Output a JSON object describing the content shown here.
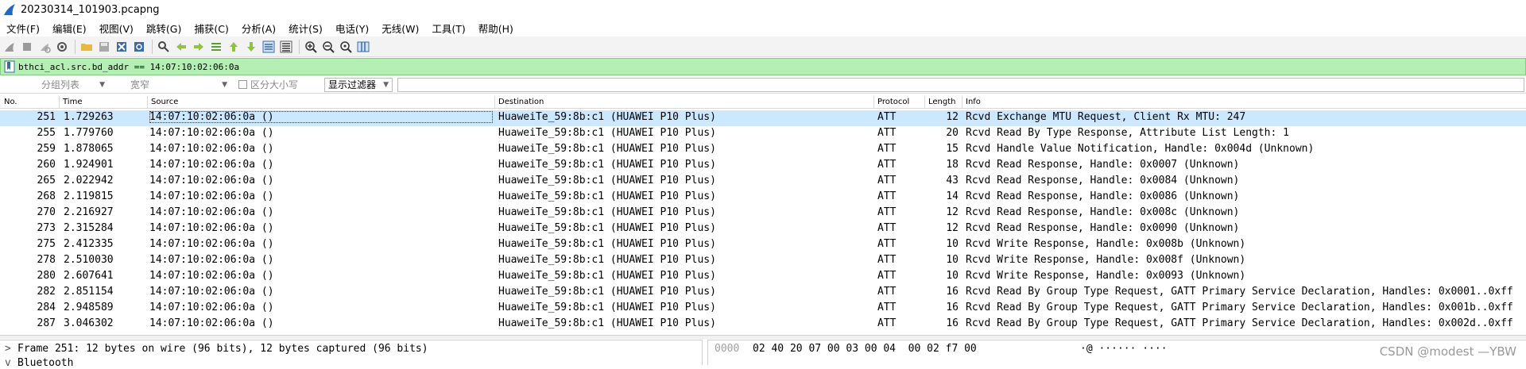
{
  "window": {
    "title": "20230314_101903.pcapng"
  },
  "menu": [
    "文件(F)",
    "编辑(E)",
    "视图(V)",
    "跳转(G)",
    "捕获(C)",
    "分析(A)",
    "统计(S)",
    "电话(Y)",
    "无线(W)",
    "工具(T)",
    "帮助(H)"
  ],
  "toolbar": {
    "icons": [
      "shark-fin-start-icon",
      "stop-icon",
      "restart-icon",
      "options-gear-icon",
      "open-folder-icon",
      "save-icon",
      "close-file-icon",
      "reload-icon",
      "find-icon",
      "back-arrow-icon",
      "forward-arrow-icon",
      "go-to-packet-icon",
      "first-packet-icon",
      "last-packet-icon",
      "autoscroll-icon",
      "colorize-icon",
      "zoom-in-icon",
      "zoom-out-icon",
      "normal-size-icon",
      "resize-columns-icon"
    ]
  },
  "filter": {
    "text": "bthci_acl.src.bd_addr == 14:07:10:02:06:0a"
  },
  "search": {
    "scope": "分组列表",
    "charset": "宽窄",
    "case_label": "区分大小写",
    "type": "显示过滤器"
  },
  "columns": [
    "No.",
    "Time",
    "Source",
    "Destination",
    "Protocol",
    "Length",
    "Info"
  ],
  "packets": [
    {
      "no": "251",
      "time": "1.729263",
      "source": "14:07:10:02:06:0a ()",
      "destination": "HuaweiTe_59:8b:c1 (HUAWEI P10 Plus)",
      "protocol": "ATT",
      "length": "12",
      "info": "Rcvd Exchange MTU Request, Client Rx MTU: 247"
    },
    {
      "no": "255",
      "time": "1.779760",
      "source": "14:07:10:02:06:0a ()",
      "destination": "HuaweiTe_59:8b:c1 (HUAWEI P10 Plus)",
      "protocol": "ATT",
      "length": "20",
      "info": "Rcvd Read By Type Response, Attribute List Length: 1"
    },
    {
      "no": "259",
      "time": "1.878065",
      "source": "14:07:10:02:06:0a ()",
      "destination": "HuaweiTe_59:8b:c1 (HUAWEI P10 Plus)",
      "protocol": "ATT",
      "length": "15",
      "info": "Rcvd Handle Value Notification, Handle: 0x004d (Unknown)"
    },
    {
      "no": "260",
      "time": "1.924901",
      "source": "14:07:10:02:06:0a ()",
      "destination": "HuaweiTe_59:8b:c1 (HUAWEI P10 Plus)",
      "protocol": "ATT",
      "length": "18",
      "info": "Rcvd Read Response, Handle: 0x0007 (Unknown)"
    },
    {
      "no": "265",
      "time": "2.022942",
      "source": "14:07:10:02:06:0a ()",
      "destination": "HuaweiTe_59:8b:c1 (HUAWEI P10 Plus)",
      "protocol": "ATT",
      "length": "43",
      "info": "Rcvd Read Response, Handle: 0x0084 (Unknown)"
    },
    {
      "no": "268",
      "time": "2.119815",
      "source": "14:07:10:02:06:0a ()",
      "destination": "HuaweiTe_59:8b:c1 (HUAWEI P10 Plus)",
      "protocol": "ATT",
      "length": "14",
      "info": "Rcvd Read Response, Handle: 0x0086 (Unknown)"
    },
    {
      "no": "270",
      "time": "2.216927",
      "source": "14:07:10:02:06:0a ()",
      "destination": "HuaweiTe_59:8b:c1 (HUAWEI P10 Plus)",
      "protocol": "ATT",
      "length": "12",
      "info": "Rcvd Read Response, Handle: 0x008c (Unknown)"
    },
    {
      "no": "273",
      "time": "2.315284",
      "source": "14:07:10:02:06:0a ()",
      "destination": "HuaweiTe_59:8b:c1 (HUAWEI P10 Plus)",
      "protocol": "ATT",
      "length": "12",
      "info": "Rcvd Read Response, Handle: 0x0090 (Unknown)"
    },
    {
      "no": "275",
      "time": "2.412335",
      "source": "14:07:10:02:06:0a ()",
      "destination": "HuaweiTe_59:8b:c1 (HUAWEI P10 Plus)",
      "protocol": "ATT",
      "length": "10",
      "info": "Rcvd Write Response, Handle: 0x008b (Unknown)"
    },
    {
      "no": "278",
      "time": "2.510030",
      "source": "14:07:10:02:06:0a ()",
      "destination": "HuaweiTe_59:8b:c1 (HUAWEI P10 Plus)",
      "protocol": "ATT",
      "length": "10",
      "info": "Rcvd Write Response, Handle: 0x008f (Unknown)"
    },
    {
      "no": "280",
      "time": "2.607641",
      "source": "14:07:10:02:06:0a ()",
      "destination": "HuaweiTe_59:8b:c1 (HUAWEI P10 Plus)",
      "protocol": "ATT",
      "length": "10",
      "info": "Rcvd Write Response, Handle: 0x0093 (Unknown)"
    },
    {
      "no": "282",
      "time": "2.851154",
      "source": "14:07:10:02:06:0a ()",
      "destination": "HuaweiTe_59:8b:c1 (HUAWEI P10 Plus)",
      "protocol": "ATT",
      "length": "16",
      "info": "Rcvd Read By Group Type Request, GATT Primary Service Declaration, Handles: 0x0001..0xff"
    },
    {
      "no": "284",
      "time": "2.948589",
      "source": "14:07:10:02:06:0a ()",
      "destination": "HuaweiTe_59:8b:c1 (HUAWEI P10 Plus)",
      "protocol": "ATT",
      "length": "16",
      "info": "Rcvd Read By Group Type Request, GATT Primary Service Declaration, Handles: 0x001b..0xff"
    },
    {
      "no": "287",
      "time": "3.046302",
      "source": "14:07:10:02:06:0a ()",
      "destination": "HuaweiTe_59:8b:c1 (HUAWEI P10 Plus)",
      "protocol": "ATT",
      "length": "16",
      "info": "Rcvd Read By Group Type Request, GATT Primary Service Declaration, Handles: 0x002d..0xff"
    }
  ],
  "selected_index": 0,
  "details": {
    "frame_line": "Frame 251: 12 bytes on wire (96 bits), 12 bytes captured (96 bits)",
    "bluetooth_line": "Bluetooth",
    "expander_collapsed": ">",
    "expander_open": "v"
  },
  "bytes": {
    "offset": "0000",
    "hex": "02 40 20 07 00 03 00 04  00 02 f7 00",
    "ascii": "·@ ······ ····"
  },
  "watermark": "CSDN @modest —YBW",
  "colors": {
    "filter_bg": "#b4f0b4",
    "selected_row": "#cce8ff"
  }
}
